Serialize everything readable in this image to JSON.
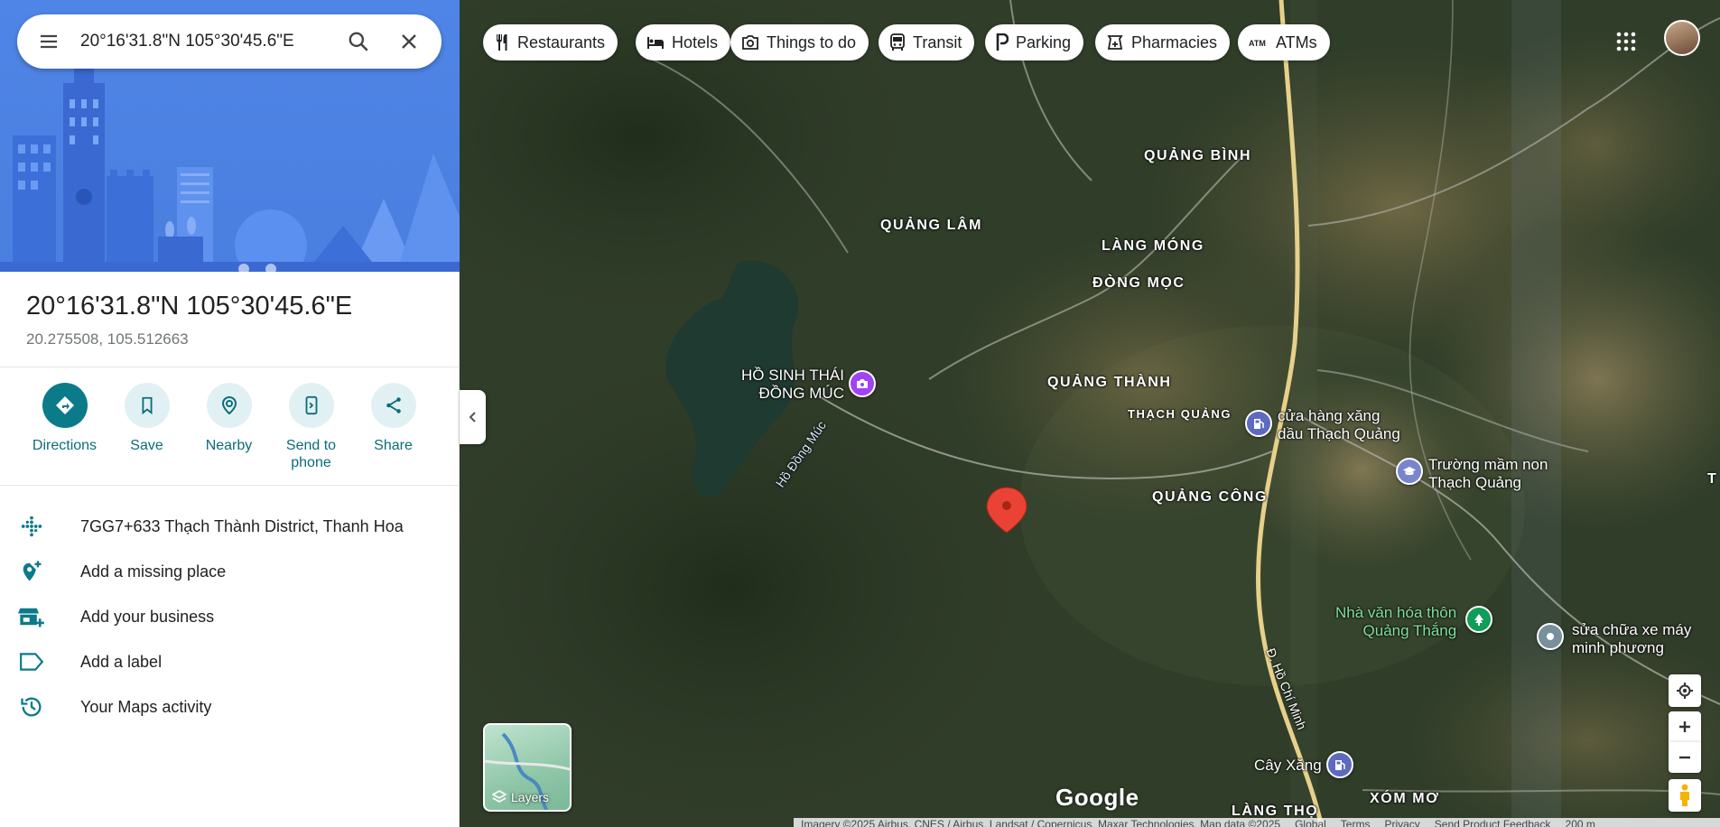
{
  "search": {
    "value": "20°16'31.8\"N 105°30'45.6\"E"
  },
  "place": {
    "title": "20°16'31.8\"N 105°30'45.6\"E",
    "decimal": "20.275508, 105.512663"
  },
  "actions": [
    {
      "label": "Directions",
      "icon": "directions-icon"
    },
    {
      "label": "Save",
      "icon": "bookmark-icon"
    },
    {
      "label": "Nearby",
      "icon": "nearby-icon"
    },
    {
      "label": "Send to phone",
      "icon": "send-to-phone-icon"
    },
    {
      "label": "Share",
      "icon": "share-icon"
    }
  ],
  "info_rows": [
    {
      "text": "7GG7+633 Thạch Thành District, Thanh Hoa",
      "icon": "plus-code-icon"
    },
    {
      "text": "Add a missing place",
      "icon": "add-place-icon"
    },
    {
      "text": "Add your business",
      "icon": "storefront-icon"
    },
    {
      "text": "Add a label",
      "icon": "label-icon"
    },
    {
      "text": "Your Maps activity",
      "icon": "history-icon"
    }
  ],
  "chips": [
    {
      "label": "Restaurants",
      "icon": "fork-knife-icon"
    },
    {
      "label": "Hotels",
      "icon": "bed-icon"
    },
    {
      "label": "Things to do",
      "icon": "camera-icon"
    },
    {
      "label": "Transit",
      "icon": "bus-icon"
    },
    {
      "label": "Parking",
      "icon": "parking-icon"
    },
    {
      "label": "Pharmacies",
      "icon": "pharmacy-icon"
    },
    {
      "label": "ATMs",
      "icon": "atm-icon"
    }
  ],
  "map_labels": {
    "quang_binh": "QUẢNG BÌNH",
    "quang_lam": "QUẢNG LÂM",
    "lang_mong": "LÀNG MÓNG",
    "dong_moc": "ĐÒNG MỌC",
    "quang_thanh": "QUẢNG THÀNH",
    "thach_quang": "THẠCH QUẢNG",
    "quang_cong": "QUẢNG CÔNG",
    "lang_tho": "LÀNG THỌ",
    "xom_mo": "XÓM MƠ",
    "ho_dong_muc": "Hồ Đồng Múc",
    "hcm_road": "Đ. Hồ Chí Minh",
    "edge_t": "T"
  },
  "pois": [
    {
      "key": "eco_lake",
      "text": "HỒ SINH THÁI\nĐỒNG MÚC",
      "color": "#a142f4"
    },
    {
      "key": "gas_station",
      "text": "cửa hàng xăng\ndầu Thạch Quảng",
      "color": "#5c6bc0"
    },
    {
      "key": "school",
      "text": "Trường mầm non\nThạch Quảng",
      "color": "#7986cb"
    },
    {
      "key": "culture_house",
      "text": "Nhà văn hóa thôn\nQuảng Thắng",
      "color": "#0f9d58"
    },
    {
      "key": "repair_shop",
      "text": "sửa chữa xe máy\nminh phương",
      "color": "#78909c"
    },
    {
      "key": "cay_xang",
      "text": "Cây Xăng",
      "color": "#5c6bc0"
    }
  ],
  "layers_label": "Layers",
  "google_logo": "Google",
  "attribution": {
    "imagery": "Imagery ©2025 Airbus, CNES / Airbus, Landsat / Copernicus, Maxar Technologies, Map data ©2025",
    "global": "Global",
    "terms": "Terms",
    "privacy": "Privacy",
    "feedback": "Send Product Feedback",
    "scale": "200 m"
  },
  "colors": {
    "accent": "#0b7b8a",
    "hero_blue": "#4a7fe0",
    "pin_red": "#ea4335"
  }
}
